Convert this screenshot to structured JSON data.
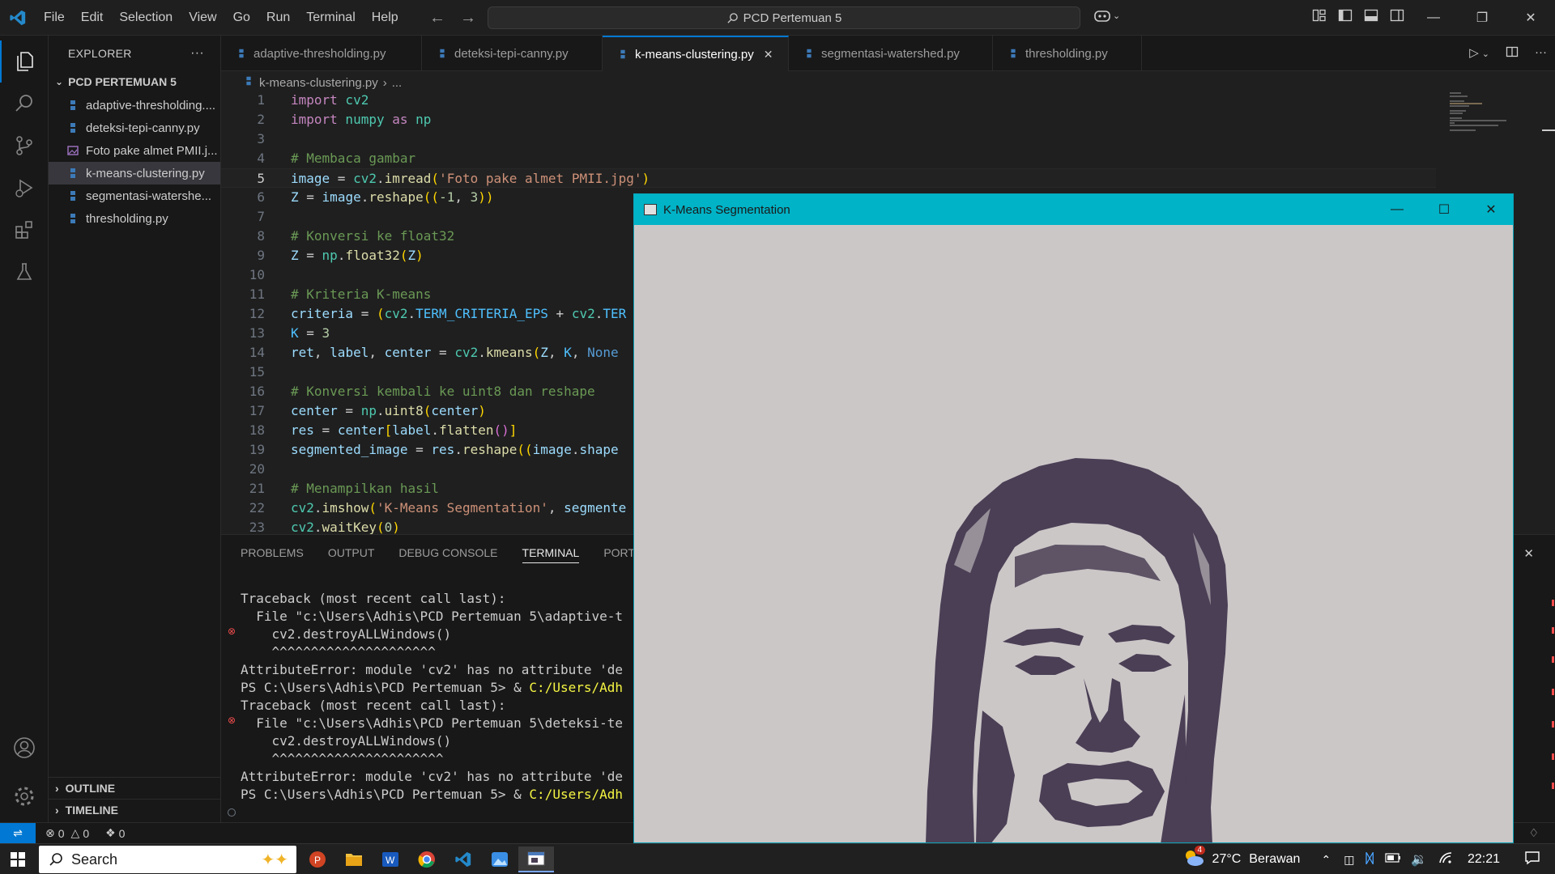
{
  "titlebar": {
    "menu": [
      "File",
      "Edit",
      "Selection",
      "View",
      "Go",
      "Run",
      "Terminal",
      "Help"
    ],
    "search_text": "PCD Pertemuan 5"
  },
  "sidebar": {
    "header": "EXPLORER",
    "folder": "PCD PERTEMUAN 5",
    "files": [
      {
        "name": "adaptive-thresholding....",
        "type": "python"
      },
      {
        "name": "deteksi-tepi-canny.py",
        "type": "python"
      },
      {
        "name": "Foto pake almet PMII.j...",
        "type": "image"
      },
      {
        "name": "k-means-clustering.py",
        "type": "python",
        "selected": true
      },
      {
        "name": "segmentasi-watershe...",
        "type": "python"
      },
      {
        "name": "thresholding.py",
        "type": "python"
      }
    ],
    "outline": "OUTLINE",
    "timeline": "TIMELINE"
  },
  "tabs": [
    {
      "label": "adaptive-thresholding.py"
    },
    {
      "label": "deteksi-tepi-canny.py"
    },
    {
      "label": "k-means-clustering.py",
      "active": true
    },
    {
      "label": "segmentasi-watershed.py"
    },
    {
      "label": "thresholding.py"
    }
  ],
  "breadcrumb": {
    "file": "k-means-clustering.py",
    "rest": "..."
  },
  "editor": {
    "current_line": 5,
    "line_numbers": [
      "1",
      "2",
      "3",
      "4",
      "5",
      "6",
      "7",
      "8",
      "9",
      "10",
      "11",
      "12",
      "13",
      "14",
      "15",
      "16",
      "17",
      "18",
      "19",
      "20",
      "21",
      "22",
      "23"
    ],
    "l1": {
      "a": "import",
      "b": " cv2"
    },
    "l2": {
      "a": "import",
      "b": " numpy ",
      "c": "as",
      "d": " np"
    },
    "l4": "# Membaca gambar",
    "l5": {
      "a": "image",
      "b": " = ",
      "c": "cv2",
      "d": ".",
      "e": "imread",
      "f": "(",
      "g": "'Foto pake almet PMII.jpg'",
      "h": ")"
    },
    "l6": {
      "a": "Z",
      "b": " = ",
      "c": "image",
      "d": ".",
      "e": "reshape",
      "f": "((",
      "g": "-1",
      "h": ", ",
      "i": "3",
      "j": "))"
    },
    "l8": "# Konversi ke float32",
    "l9": {
      "a": "Z",
      "b": " = ",
      "c": "np",
      "d": ".",
      "e": "float32",
      "f": "(",
      "g": "Z",
      "h": ")"
    },
    "l11": "# Kriteria K-means",
    "l12": {
      "a": "criteria",
      "b": " = ",
      "c": "(",
      "d": "cv2",
      "e": ".",
      "f": "TERM_CRITERIA_EPS",
      "g": " + ",
      "h": "cv2",
      "i": ".",
      "j": "TER"
    },
    "l13": {
      "a": "K",
      "b": " = ",
      "c": "3"
    },
    "l14": {
      "a": "ret",
      "b": ", ",
      "c": "label",
      "d": ", ",
      "e": "center",
      "f": " = ",
      "g": "cv2",
      "h": ".",
      "i": "kmeans",
      "j": "(",
      "k": "Z",
      "l": ", ",
      "m": "K",
      "n": ", ",
      "o": "None"
    },
    "l16": "# Konversi kembali ke uint8 dan reshape",
    "l17": {
      "a": "center",
      "b": " = ",
      "c": "np",
      "d": ".",
      "e": "uint8",
      "f": "(",
      "g": "center",
      "h": ")"
    },
    "l18": {
      "a": "res",
      "b": " = ",
      "c": "center",
      "d": "[",
      "e": "label",
      "f": ".",
      "g": "flatten",
      "h": "()",
      "i": "]"
    },
    "l19": {
      "a": "segmented_image",
      "b": " = ",
      "c": "res",
      "d": ".",
      "e": "reshape",
      "f": "((",
      "g": "image",
      "h": ".",
      "i": "shape"
    },
    "l21": "# Menampilkan hasil",
    "l22": {
      "a": "cv2",
      "b": ".",
      "c": "imshow",
      "d": "(",
      "e": "'K-Means Segmentation'",
      "f": ", ",
      "g": "segmente"
    },
    "l23": {
      "a": "cv2",
      "b": ".",
      "c": "waitKey",
      "d": "(",
      "e": "0",
      "f": ")"
    }
  },
  "panel": {
    "tabs": [
      "PROBLEMS",
      "OUTPUT",
      "DEBUG CONSOLE",
      "TERMINAL",
      "PORTS"
    ],
    "active_tab": "TERMINAL",
    "terminal_lines": [
      "Traceback (most recent call last):",
      "  File \"c:\\Users\\Adhis\\PCD Pertemuan 5\\adaptive-t",
      "    cv2.destroyALLWindows()",
      "    ^^^^^^^^^^^^^^^^^^^^^",
      "AttributeError: module 'cv2' has no attribute 'de",
      "PS C:\\Users\\Adhis\\PCD Pertemuan 5> & ",
      "Traceback (most recent call last):",
      "  File \"c:\\Users\\Adhis\\PCD Pertemuan 5\\deteksi-te",
      "    cv2.destroyALLWindows()",
      "    ^^^^^^^^^^^^^^^^^^^^^^",
      "AttributeError: module 'cv2' has no attribute 'de",
      "PS C:\\Users\\Adhis\\PCD Pertemuan 5> & "
    ],
    "terminal_path_1": "C:/Users/Adh",
    "terminal_path_2": "C:/Users/Adh"
  },
  "statusbar": {
    "errors": "0",
    "warnings": "0",
    "ports": "0"
  },
  "cv_window": {
    "title": "K-Means Segmentation"
  },
  "taskbar": {
    "search_label": "Search",
    "weather_temp": "27°C",
    "weather_text": "Berawan",
    "weather_badge": "4",
    "time": "22:21"
  },
  "colors": {
    "accent": "#0078d4",
    "cv_title": "#00b3c7",
    "segment_light": "#ccc7c7",
    "segment_dark": "#4a3f55"
  }
}
